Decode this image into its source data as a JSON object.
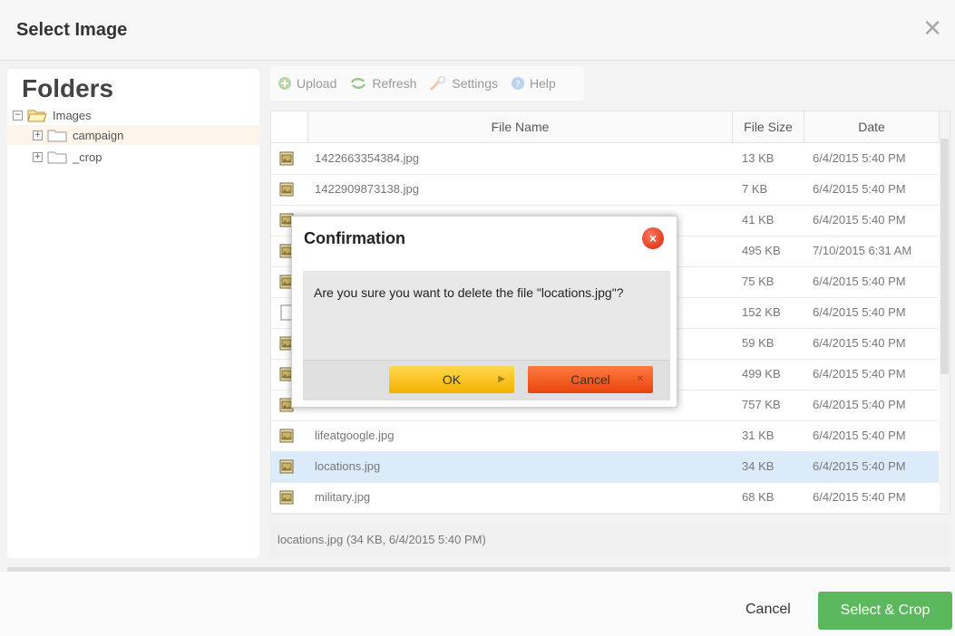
{
  "dialog": {
    "title": "Select Image",
    "close_glyph": "✕"
  },
  "folders": {
    "title": "Folders",
    "tree": [
      {
        "label": "Images",
        "toggle": "−",
        "level": 0,
        "open": true
      },
      {
        "label": "campaign",
        "toggle": "+",
        "level": 1,
        "selected": true
      },
      {
        "label": "_crop",
        "toggle": "+",
        "level": 1
      }
    ]
  },
  "toolbar": {
    "upload": "Upload",
    "refresh": "Refresh",
    "settings": "Settings",
    "help": "Help"
  },
  "grid": {
    "columns": {
      "name": "File Name",
      "size": "File Size",
      "date": "Date"
    },
    "rows": [
      {
        "name": "1422663354384.jpg",
        "size": "13 KB",
        "date": "6/4/2015 5:40 PM",
        "icon": "image-file-icon"
      },
      {
        "name": "1422909873138.jpg",
        "size": "7 KB",
        "date": "6/4/2015 5:40 PM",
        "icon": "image-file-icon"
      },
      {
        "name": "",
        "size": "41 KB",
        "date": "6/4/2015 5:40 PM",
        "icon": "image-file-icon"
      },
      {
        "name": "",
        "size": "495 KB",
        "date": "7/10/2015 6:31 AM",
        "icon": "image-file-icon"
      },
      {
        "name": "",
        "size": "75 KB",
        "date": "6/4/2015 5:40 PM",
        "icon": "image-file-icon"
      },
      {
        "name": "",
        "size": "152 KB",
        "date": "6/4/2015 5:40 PM",
        "icon": "blank-file-icon"
      },
      {
        "name": "",
        "size": "59 KB",
        "date": "6/4/2015 5:40 PM",
        "icon": "image-file-icon"
      },
      {
        "name": "",
        "size": "499 KB",
        "date": "6/4/2015 5:40 PM",
        "icon": "image-file-icon"
      },
      {
        "name": "",
        "size": "757 KB",
        "date": "6/4/2015 5:40 PM",
        "icon": "image-file-icon"
      },
      {
        "name": "lifeatgoogle.jpg",
        "size": "31 KB",
        "date": "6/4/2015 5:40 PM",
        "icon": "image-file-icon"
      },
      {
        "name": "locations.jpg",
        "size": "34 KB",
        "date": "6/4/2015 5:40 PM",
        "icon": "image-file-icon",
        "selected": true
      },
      {
        "name": "military.jpg",
        "size": "68 KB",
        "date": "6/4/2015 5:40 PM",
        "icon": "image-file-icon"
      }
    ]
  },
  "status": {
    "text": "locations.jpg (34 KB, 6/4/2015 5:40 PM)"
  },
  "footer": {
    "cancel": "Cancel",
    "select_crop": "Select & Crop"
  },
  "confirmation": {
    "title": "Confirmation",
    "message": "Are you sure you want to delete the file \"locations.jpg\"?",
    "ok": "OK",
    "cancel": "Cancel",
    "close_glyph": "×"
  },
  "colors": {
    "accent_green": "#5cb85c",
    "ok_yellow": "#f4b100",
    "cancel_orange": "#e8430d",
    "selected_row": "#dcebf9"
  }
}
